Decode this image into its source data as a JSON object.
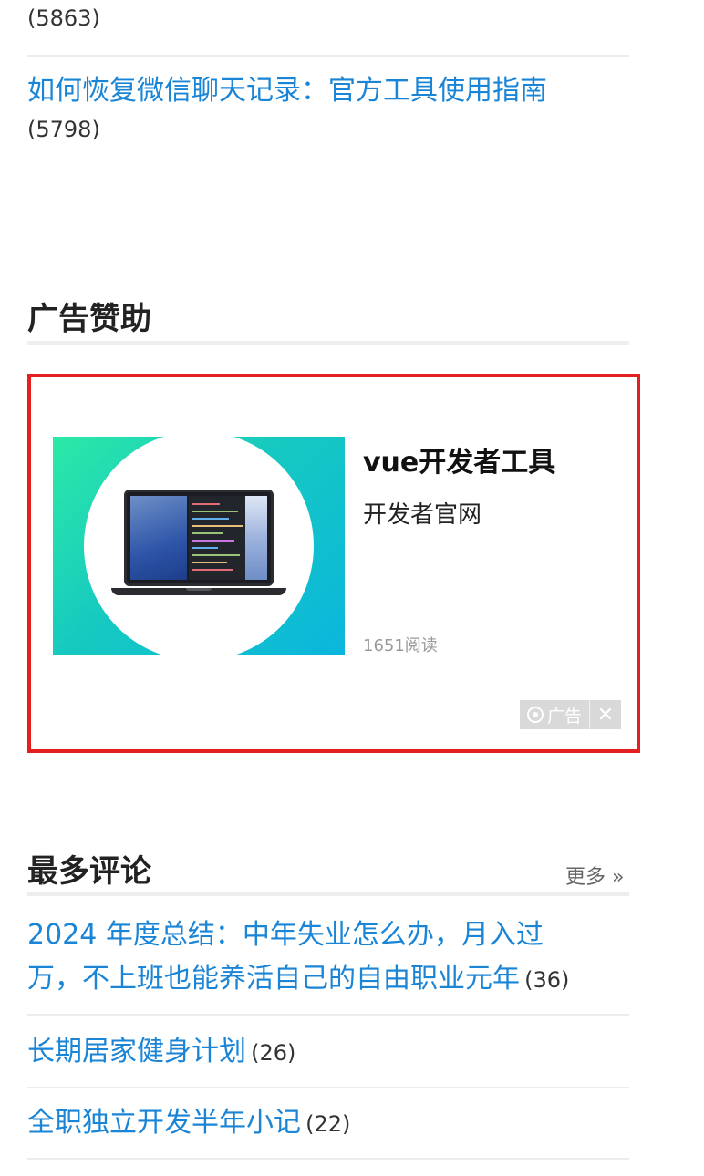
{
  "popular": {
    "prev_count": "(5863)",
    "items": [
      {
        "title": "如何恢复微信聊天记录：官方工具使用指南",
        "count": "(5798)"
      }
    ]
  },
  "ad_section": {
    "title": "广告赞助",
    "ad": {
      "title": "vue开发者工具",
      "subtitle": "开发者官网",
      "reads": "1651阅读",
      "badge_label": "广告",
      "close_glyph": "✕"
    }
  },
  "comments_section": {
    "title": "最多评论",
    "more_label": "更多 »",
    "items": [
      {
        "title_line1": "2024 年度总结：中年失业怎么办，月入过",
        "title_line2": "万，不上班也能养活自己的自由职业元年",
        "count": "(36)"
      },
      {
        "title": "长期居家健身计划",
        "count": "(26)"
      },
      {
        "title": "全职独立开发半年小记",
        "count": "(22)"
      }
    ]
  },
  "colors": {
    "link": "#1a85d6",
    "ad_border": "#e41f1f",
    "divider": "#ececec"
  }
}
